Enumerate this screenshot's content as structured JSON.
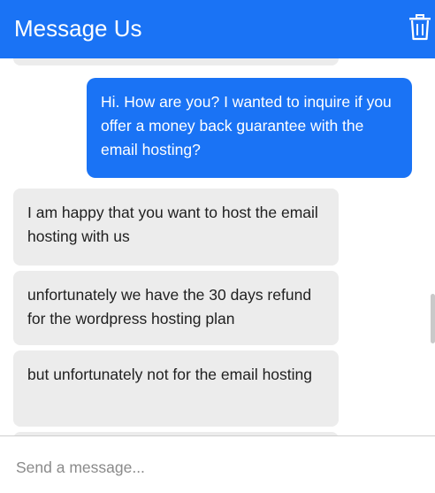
{
  "header": {
    "title": "Message Us",
    "delete_icon": "trash-icon"
  },
  "messages": [
    {
      "from": "user",
      "text": "Hi. How are you? I wanted to inquire if you offer a money back guarantee with the email hosting?"
    },
    {
      "from": "agent",
      "text": "I am happy that you want to host the email hosting with us"
    },
    {
      "from": "agent",
      "text": "unfortunately we have the 30 days refund for the wordpress hosting plan"
    },
    {
      "from": "agent",
      "text": "but unfortunately not for the email hosting"
    }
  ],
  "composer": {
    "placeholder": "Send a message...",
    "value": ""
  },
  "colors": {
    "accent": "#1a73f5",
    "agent_bubble": "#ececec",
    "text_dark": "#1f1f1f"
  }
}
